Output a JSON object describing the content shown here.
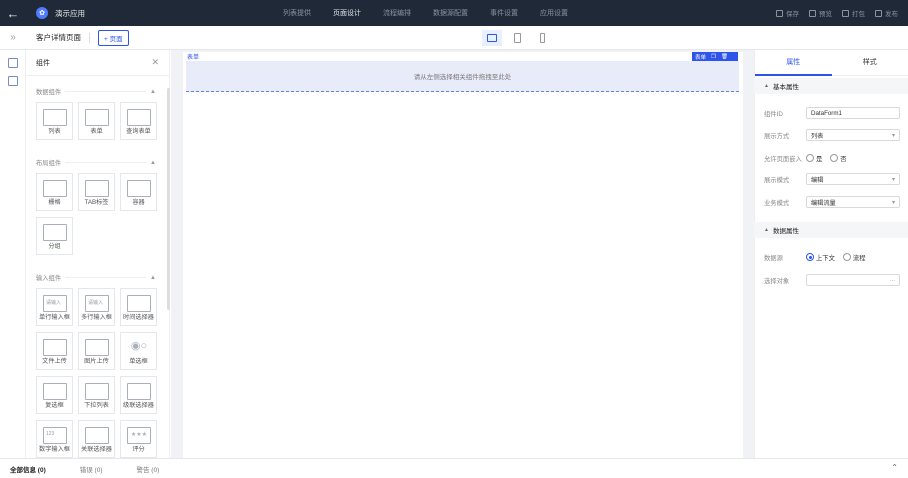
{
  "app": {
    "name": "演示应用"
  },
  "nav": {
    "tabs": [
      "列表提供",
      "页面设计",
      "流程编排",
      "数据源配置",
      "事件设置",
      "应用设置"
    ],
    "active": 1
  },
  "actions": [
    "保存",
    "预览",
    "打包",
    "发布"
  ],
  "subbar": {
    "page_title": "客户详情页面",
    "add_page": "+ 页面"
  },
  "components": {
    "header": "组件",
    "sections": [
      {
        "title": "数据组件",
        "items": [
          "列表",
          "表单",
          "查询表单"
        ]
      },
      {
        "title": "布局组件",
        "items": [
          "栅格",
          "TAB标签",
          "容器",
          "分组"
        ]
      },
      {
        "title": "输入组件",
        "items": [
          "单行输入框",
          "多行输入框",
          "时间选择器",
          "文件上传",
          "图片上传",
          "单选框",
          "复选框",
          "下拉列表",
          "级联选择器",
          "数字输入框",
          "关联选择器",
          "评分"
        ]
      }
    ],
    "input_placeholder_1": "请输入",
    "input_placeholder_2": "请输入",
    "number_sample": "123"
  },
  "canvas": {
    "form_label": "表单",
    "toolbar_label": "表单",
    "dropzone_text": "请从左侧选择相关组件拖拽至此处"
  },
  "props": {
    "tabs": [
      "属性",
      "样式"
    ],
    "active_tab": 0,
    "basic_group": "基本属性",
    "fields": [
      {
        "label": "组件ID",
        "value": "DataForm1"
      },
      {
        "label": "展示方式",
        "value": "列表"
      },
      {
        "label": "允许页面嵌入",
        "radio": [
          "是",
          "否"
        ]
      },
      {
        "label": "展示模式",
        "value": "编辑"
      },
      {
        "label": "业务模式",
        "value": "编辑流量"
      }
    ],
    "data_group": "数据属性",
    "data_source_label": "数据源",
    "data_source_options": [
      "上下文",
      "流程"
    ],
    "data_source_selected": 0,
    "select_object_label": "选择对象",
    "select_object_value": "..."
  },
  "bottom": {
    "tabs": [
      "全部信息 (0)",
      "错误 (0)",
      "警告 (0)"
    ],
    "active": 0
  }
}
